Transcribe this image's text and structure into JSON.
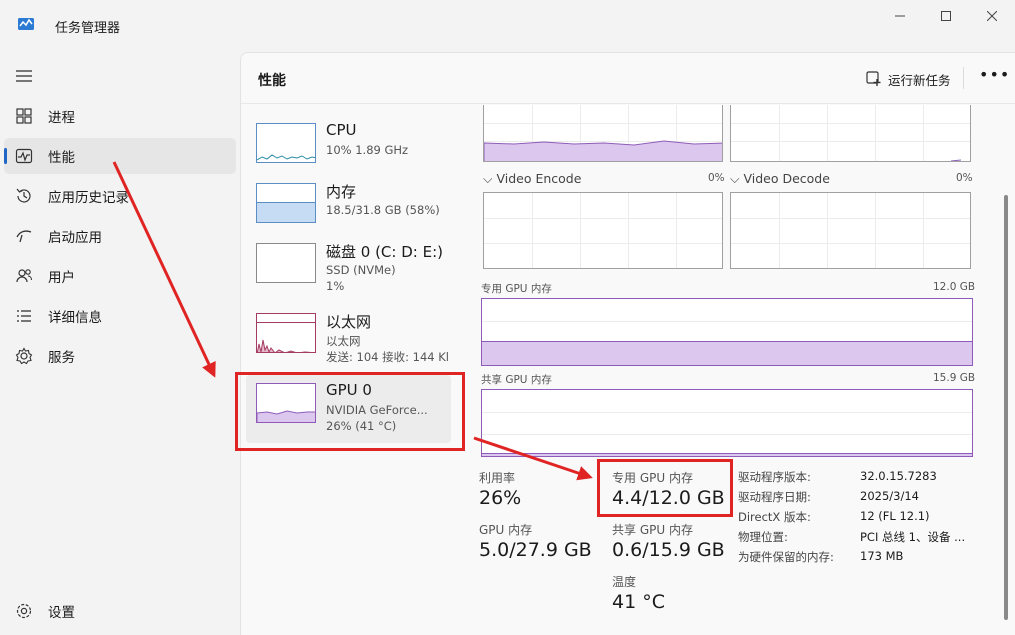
{
  "window": {
    "title": "任务管理器",
    "accent": "#1f66c5"
  },
  "sidebar": {
    "items": [
      {
        "label": "进程",
        "icon": "processes-icon"
      },
      {
        "label": "性能",
        "icon": "performance-icon",
        "active": true
      },
      {
        "label": "应用历史记录",
        "icon": "history-icon"
      },
      {
        "label": "启动应用",
        "icon": "startup-icon"
      },
      {
        "label": "用户",
        "icon": "users-icon"
      },
      {
        "label": "详细信息",
        "icon": "details-icon"
      },
      {
        "label": "服务",
        "icon": "services-icon"
      }
    ],
    "settings": "设置"
  },
  "header": {
    "title": "性能",
    "run_task": "运行新任务"
  },
  "devices": [
    {
      "name": "CPU",
      "sub1": "10% 1.89 GHz",
      "sub2": ""
    },
    {
      "name": "内存",
      "sub1": "18.5/31.8 GB (58%)",
      "sub2": ""
    },
    {
      "name": "磁盘 0 (C: D: E:)",
      "sub1": "SSD (NVMe)",
      "sub2": "1%"
    },
    {
      "name": "以太网",
      "sub1": "以太网",
      "sub2": "发送: 104 接收: 144 Kl"
    },
    {
      "name": "GPU 0",
      "sub1": "NVIDIA GeForce...",
      "sub2": "26% (41 °C)",
      "selected": true
    }
  ],
  "gpu_panel": {
    "video_encode": {
      "label": "Video Encode",
      "value": "0%"
    },
    "video_decode": {
      "label": "Video Decode",
      "value": "0%"
    },
    "dedicated": {
      "label": "专用 GPU 内存",
      "max": "12.0 GB"
    },
    "shared": {
      "label": "共享 GPU 内存",
      "max": "15.9 GB"
    }
  },
  "stats": {
    "utilization": {
      "label": "利用率",
      "value": "26%"
    },
    "dedicated_mem": {
      "label": "专用 GPU 内存",
      "value": "4.4/12.0 GB"
    },
    "gpu_mem": {
      "label": "GPU 内存",
      "value": "5.0/27.9 GB"
    },
    "shared_mem": {
      "label": "共享 GPU 内存",
      "value": "0.6/15.9 GB"
    },
    "temperature": {
      "label": "温度",
      "value": "41 °C"
    }
  },
  "info": [
    {
      "key": "驱动程序版本:",
      "value": "32.0.15.7283"
    },
    {
      "key": "驱动程序日期:",
      "value": "2025/3/14"
    },
    {
      "key": "DirectX 版本:",
      "value": "12 (FL 12.1)"
    },
    {
      "key": "物理位置:",
      "value": "PCI 总线 1、设备 ..."
    },
    {
      "key": "为硬件保留的内存:",
      "value": "173 MB"
    }
  ],
  "colors": {
    "gpu": "#8e5cb8",
    "memory": "#5b8ec4",
    "ethernet": "#a33b62",
    "highlight": "#e02424"
  }
}
